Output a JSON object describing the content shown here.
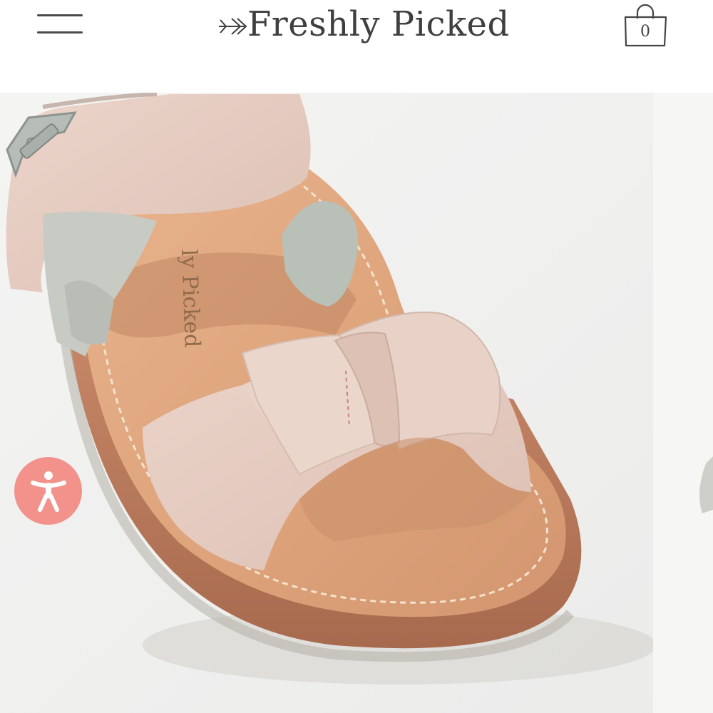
{
  "header": {
    "brand_name": "Freshly Picked",
    "cart_count": "0"
  },
  "product_image": {
    "insole_stamp": "ly Picked"
  },
  "icons": {
    "menu": "hamburger-menu-icon",
    "cart": "shopping-bag-icon",
    "logo": "arrow-logo-icon",
    "accessibility": "accessibility-person-icon"
  },
  "colors": {
    "accessibility_button": "#f2928b",
    "text": "#3f3f3f",
    "leather_strap": "#e6cdc3",
    "insole": "#dda27a"
  }
}
